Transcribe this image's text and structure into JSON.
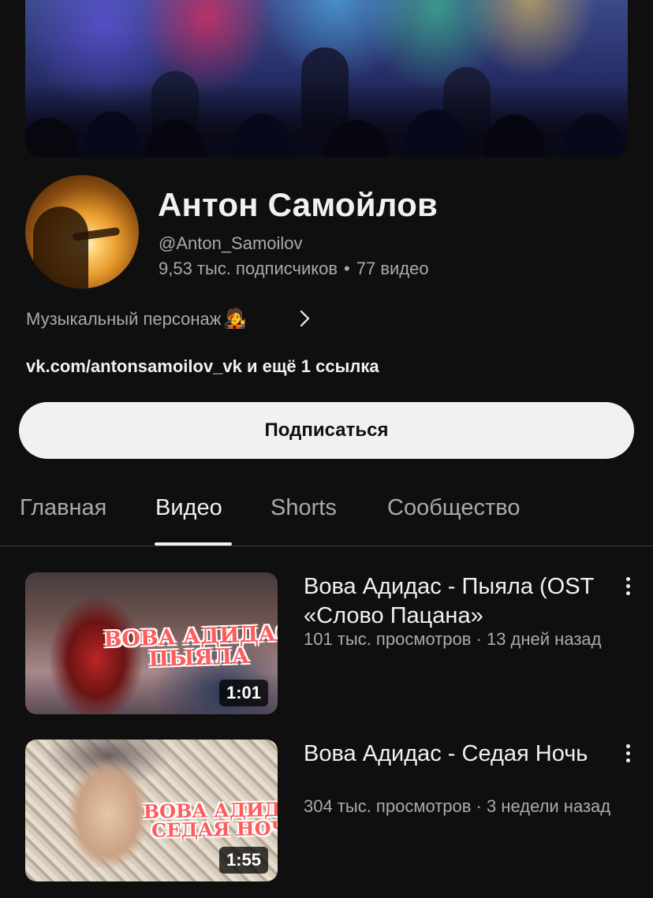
{
  "channel": {
    "name": "Антон Самойлов",
    "handle": "@Anton_Samoilov",
    "subscribers": "9,53 тыс. подписчиков",
    "separator": "•",
    "video_count": "77 видео",
    "description": "Музыкальный персонаж",
    "description_emoji": "🧑‍🎤",
    "links": "vk.com/antonsamoilov_vk и ещё 1 ссылка",
    "subscribe_label": "Подписаться"
  },
  "tabs": [
    {
      "label": "Главная",
      "active": false
    },
    {
      "label": "Видео",
      "active": true
    },
    {
      "label": "Shorts",
      "active": false
    },
    {
      "label": "Сообщество",
      "active": false
    }
  ],
  "videos": [
    {
      "title": "Вова Адидас - Пыяла (OST «Слово Пацана»",
      "meta": "101 тыс. просмотров · 13 дней назад",
      "duration": "1:01",
      "thumb_text_line1": "ВОВА АДИДАС",
      "thumb_text_line2": "ПЫЯЛА"
    },
    {
      "title": "Вова Адидас - Седая Ночь",
      "meta": "304 тыс. просмотров · 3 недели назад",
      "duration": "1:55",
      "thumb_text_line1": "ВОВА АДИДАС",
      "thumb_text_line2": "СЕДАЯ НОЧЬ"
    }
  ],
  "icons": {
    "chevron": "chevron-right-icon",
    "more": "more-vertical-icon"
  },
  "colors": {
    "background": "#0f0f0f",
    "text_primary": "#f1f1f1",
    "text_secondary": "#aaaaaa",
    "subscribe_bg": "#f1f1f1"
  }
}
